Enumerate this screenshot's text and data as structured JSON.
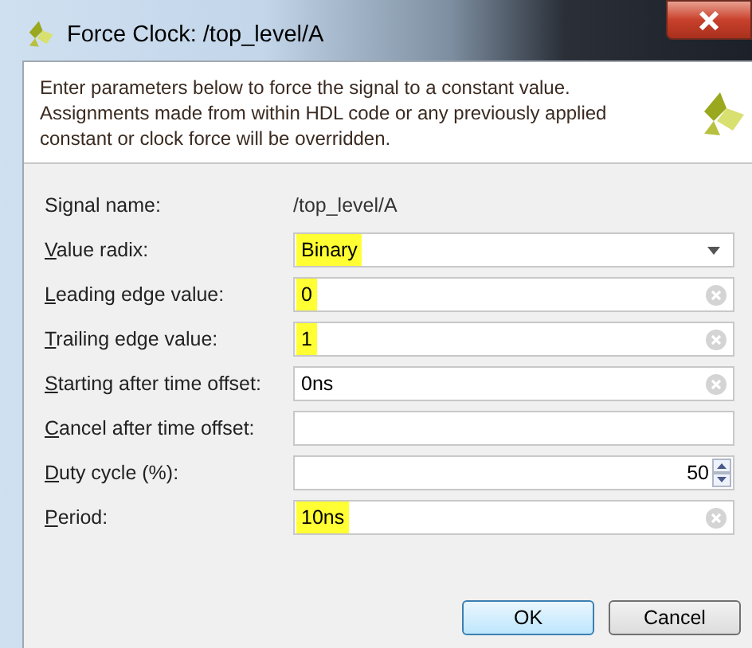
{
  "window": {
    "title": "Force Clock:  /top_level/A"
  },
  "description": "Enter parameters below to force the signal to a constant value. Assignments made from within HDL code or any previously applied constant or clock force will be overridden.",
  "fields": [
    {
      "kind": "static",
      "label": "Signal name:",
      "mnemonic": false,
      "value": "/top_level/A"
    },
    {
      "kind": "dropdown",
      "label": "Value radix:",
      "mnemonic": true,
      "value": "Binary",
      "highlighted": true
    },
    {
      "kind": "input",
      "label": "Leading edge value:",
      "mnemonic": true,
      "value": "0",
      "highlighted": true,
      "clearable": true
    },
    {
      "kind": "input",
      "label": "Trailing edge value:",
      "mnemonic": true,
      "value": "1",
      "highlighted": true,
      "clearable": true
    },
    {
      "kind": "input",
      "label": "Starting after time offset:",
      "mnemonic": true,
      "value": "0ns",
      "highlighted": false,
      "clearable": true
    },
    {
      "kind": "input",
      "label": "Cancel after time offset:",
      "mnemonic": true,
      "clearable": false
    },
    {
      "kind": "spinner",
      "label": "Duty cycle (%):",
      "mnemonic": true,
      "value": "50",
      "highlighted": false
    },
    {
      "kind": "input",
      "label": "Period:",
      "mnemonic": true,
      "value": "10ns",
      "highlighted": true,
      "clearable": true
    }
  ],
  "buttons": [
    {
      "label": "OK",
      "default": true
    },
    {
      "label": "Cancel",
      "default": false
    }
  ]
}
